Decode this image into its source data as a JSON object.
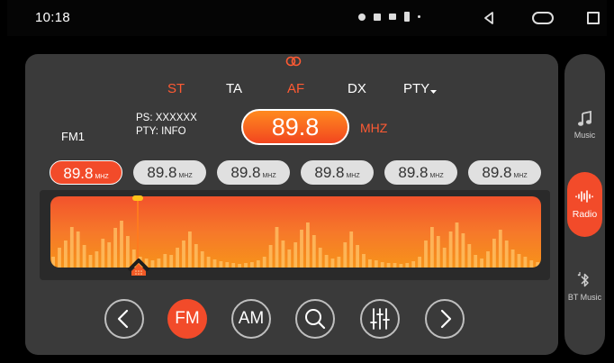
{
  "status_bar": {
    "time": "10:18"
  },
  "radio": {
    "stereo_icon": "stereo-rings-icon",
    "modes": {
      "st": "ST",
      "ta": "TA",
      "af": "AF",
      "dx": "DX",
      "pty": "PTY"
    },
    "ps": "PS: XXXXXX",
    "pty_info": "PTY: INFO",
    "band": "FM1",
    "frequency": "89.8",
    "unit": "MHZ",
    "presets": [
      {
        "freq": "89.8",
        "unit": "MHZ",
        "active": true
      },
      {
        "freq": "89.8",
        "unit": "MHZ",
        "active": false
      },
      {
        "freq": "89.8",
        "unit": "MHZ",
        "active": false
      },
      {
        "freq": "89.8",
        "unit": "MHZ",
        "active": false
      },
      {
        "freq": "89.8",
        "unit": "MHZ",
        "active": false
      },
      {
        "freq": "89.8",
        "unit": "MHZ",
        "active": false
      }
    ],
    "controls": {
      "fm": "FM",
      "am": "AM"
    }
  },
  "sidebar": {
    "music": "Music",
    "radio": "Radio",
    "bt_music": "BT Music"
  },
  "colors": {
    "accent": "#f24b2a",
    "panel": "#3a3a3a",
    "spectrum_bottom": "#f7931a"
  }
}
